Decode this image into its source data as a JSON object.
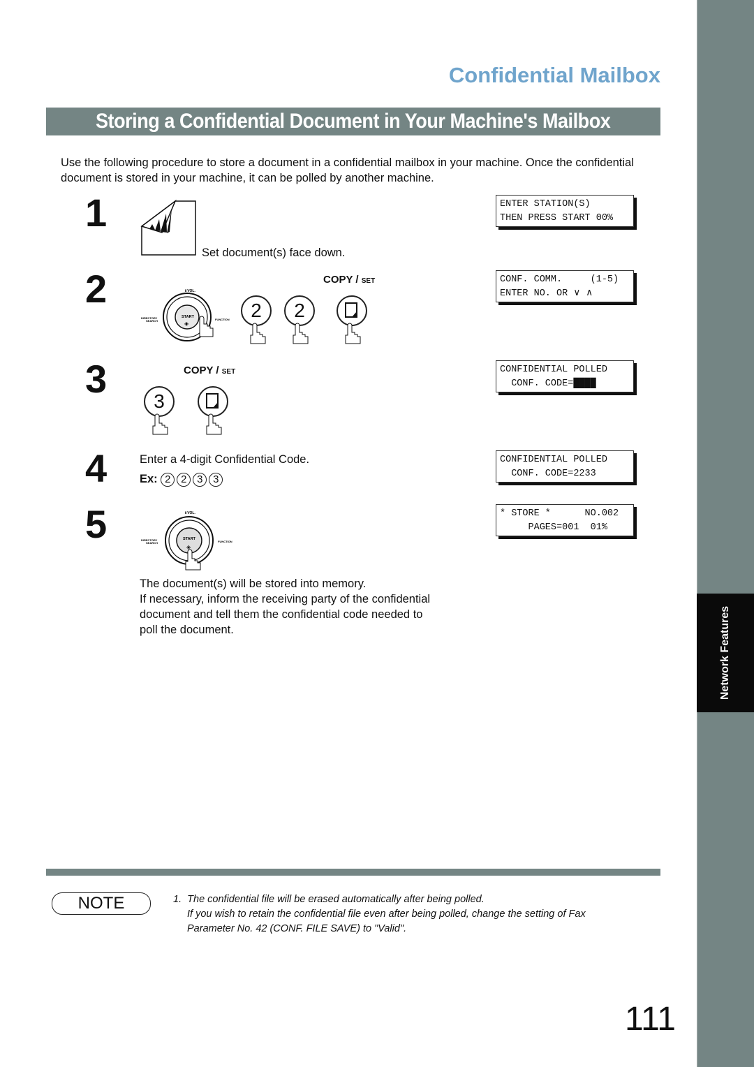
{
  "header": {
    "section_title": "Confidential Mailbox",
    "banner_title": "Storing a Confidential Document in Your Machine's Mailbox"
  },
  "intro": "Use the following procedure to store a document in a confidential mailbox in your machine.  Once the confidential document is stored in your machine, it can be polled by another machine.",
  "steps": [
    {
      "number": "1",
      "caption": "Set document(s) face down."
    },
    {
      "number": "2",
      "keys": [
        "2",
        "2"
      ],
      "copy_label": "COPY",
      "set_label": "SET"
    },
    {
      "number": "3",
      "keys": [
        "3"
      ],
      "copy_label": "COPY",
      "set_label": "SET"
    },
    {
      "number": "4",
      "caption": "Enter a 4-digit Confidential Code.",
      "example_label": "Ex:",
      "example_digits": [
        "2",
        "2",
        "3",
        "3"
      ]
    },
    {
      "number": "5",
      "lines": [
        "The document(s) will be stored into memory.",
        "If necessary, inform the receiving party of the confidential",
        "document and tell them the confidential code needed to",
        "poll the document."
      ]
    }
  ],
  "panel_labels": {
    "vol": "VOL.",
    "start": "START",
    "directory": "DIRECTORY",
    "search": "SEARCH",
    "function": "FUNCTION"
  },
  "displays": [
    {
      "line1": "ENTER STATION(S)",
      "line2": "THEN PRESS START 00%"
    },
    {
      "line1": "CONF. COMM.     (1-5)",
      "line2": "ENTER NO. OR ∨ ∧"
    },
    {
      "line1": "CONFIDENTIAL POLLED",
      "line2": "  CONF. CODE=████"
    },
    {
      "line1": "CONFIDENTIAL POLLED",
      "line2": "  CONF. CODE=2233"
    },
    {
      "line1": "* STORE *      NO.002",
      "line2": "     PAGES=001  01%"
    }
  ],
  "note": {
    "badge": "NOTE",
    "item_number": "1.",
    "lines": [
      "The confidential file will be erased automatically after being polled.",
      "If you wish to retain the confidential file even after being polled, change the setting of Fax",
      "Parameter No. 42 (CONF. FILE SAVE) to \"Valid\"."
    ]
  },
  "sidebar_tab": "Network Features",
  "page_number": "111",
  "colors": {
    "accent_blue": "#6fa4cc",
    "banner_gray": "#748584",
    "sidebar_gray": "#748584",
    "tab_black": "#0a0a0a"
  }
}
